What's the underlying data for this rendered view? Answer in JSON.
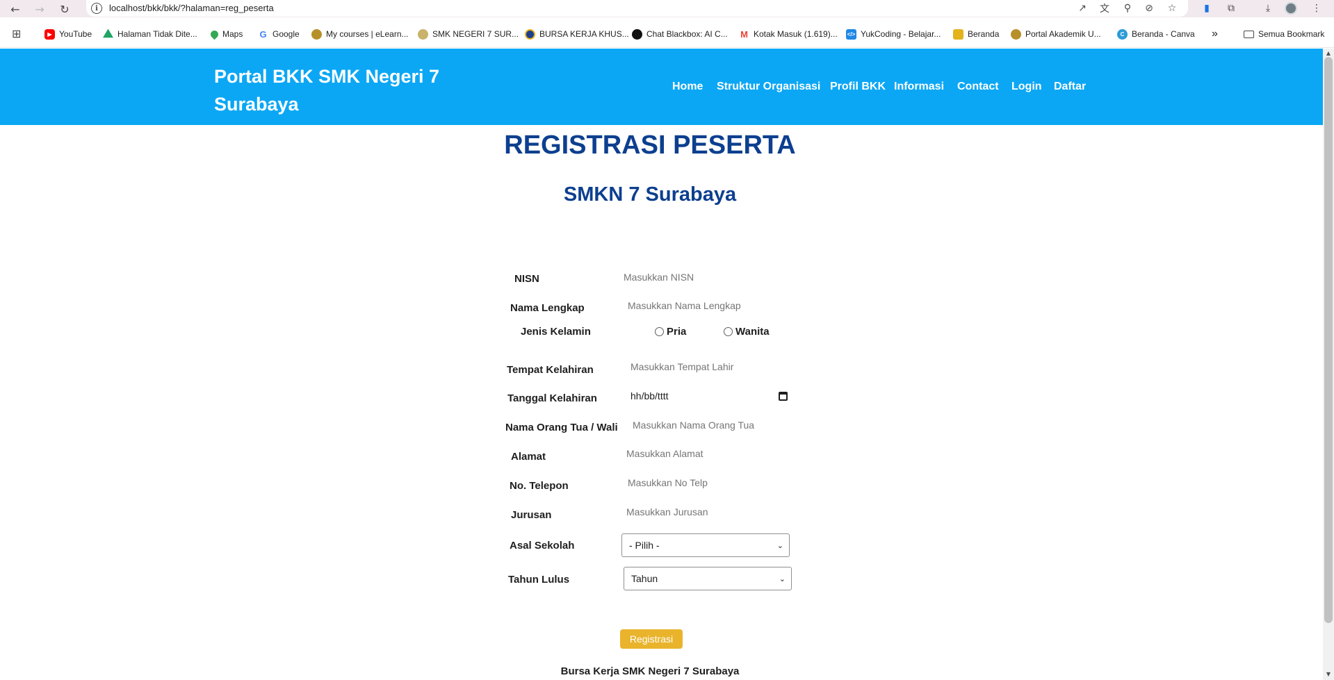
{
  "browser": {
    "url": "localhost/bkk/bkk/?halaman=reg_peserta",
    "bookmarks": [
      {
        "label": "YouTube",
        "icon": "youtube-icon",
        "color": "#ff0000"
      },
      {
        "label": "Halaman Tidak Dite...",
        "icon": "google-drive-icon",
        "color": "#1fa463"
      },
      {
        "label": "Maps",
        "icon": "maps-pin-icon",
        "color": "#34a853"
      },
      {
        "label": "Google",
        "icon": "google-icon",
        "color": "#4285f4"
      },
      {
        "label": "My courses | eLearn...",
        "icon": "school-logo-icon",
        "color": "#b8902a"
      },
      {
        "label": "SMK NEGERI 7 SUR...",
        "icon": "smk-logo-icon",
        "color": "#c9b26a"
      },
      {
        "label": "BURSA KERJA KHUS...",
        "icon": "bkk-logo-icon",
        "color": "#1c3f8f"
      },
      {
        "label": "Chat Blackbox: AI C...",
        "icon": "blackbox-icon",
        "color": "#111111"
      },
      {
        "label": "Kotak Masuk (1.619)...",
        "icon": "gmail-icon",
        "color": "#ea4335"
      },
      {
        "label": "YukCoding - Belajar...",
        "icon": "yukcoding-icon",
        "color": "#1e88e5"
      },
      {
        "label": "Beranda",
        "icon": "beranda-icon",
        "color": "#e3b31c"
      },
      {
        "label": "Portal Akademik U...",
        "icon": "portal-akademik-icon",
        "color": "#b8902a"
      },
      {
        "label": "Beranda - Canva",
        "icon": "canva-icon",
        "color": "#2b9bd8"
      }
    ],
    "more_bookmarks": "»",
    "all_bookmarks": "Semua Bookmark"
  },
  "header": {
    "brand": "Portal BKK SMK Negeri 7 Surabaya",
    "menu": [
      "Home",
      "Struktur Organisasi",
      "Profil BKK",
      "Informasi",
      "Contact",
      "Login",
      "Daftar"
    ],
    "bg_color": "#0ba7f5"
  },
  "page": {
    "title": "REGISTRASI PESERTA",
    "subtitle": "SMKN 7 Surabaya"
  },
  "form": {
    "nisn": {
      "label": "NISN",
      "placeholder": "Masukkan NISN"
    },
    "nama": {
      "label": "Nama Lengkap",
      "placeholder": "Masukkan Nama Lengkap"
    },
    "jenis_kelamin": {
      "label": "Jenis Kelamin",
      "options": [
        "Pria",
        "Wanita"
      ]
    },
    "tempat_lahir": {
      "label": "Tempat Kelahiran",
      "placeholder": "Masukkan Tempat Lahir"
    },
    "tanggal_lahir": {
      "label": "Tanggal Kelahiran",
      "value": "hh/bb/tttt"
    },
    "orang_tua": {
      "label": "Nama Orang Tua / Wali",
      "placeholder": "Masukkan Nama Orang Tua"
    },
    "alamat": {
      "label": "Alamat",
      "placeholder": "Masukkan Alamat"
    },
    "telepon": {
      "label": "No. Telepon",
      "placeholder": "Masukkan No Telp"
    },
    "jurusan": {
      "label": "Jurusan",
      "placeholder": "Masukkan Jurusan"
    },
    "asal_sekolah": {
      "label": "Asal Sekolah",
      "selected": "- Pilih -"
    },
    "tahun_lulus": {
      "label": "Tahun Lulus",
      "selected": "Tahun"
    },
    "submit_label": "Registrasi",
    "submit_color": "#e9b42c"
  },
  "footer": {
    "text": "Bursa Kerja SMK Negeri 7 Surabaya"
  }
}
